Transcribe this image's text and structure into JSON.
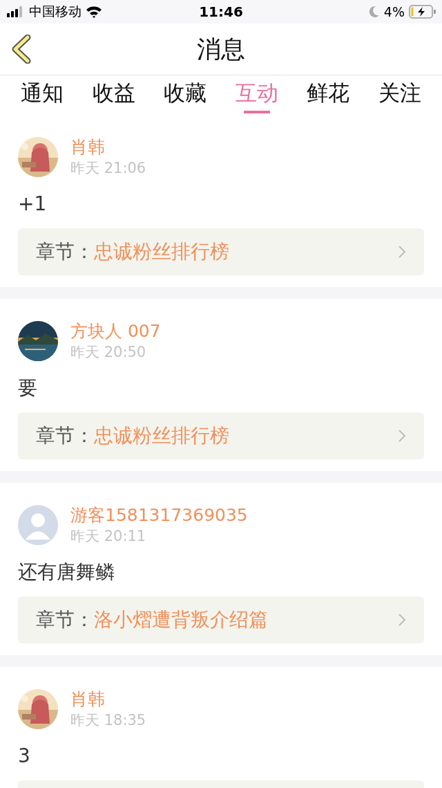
{
  "status_bar": {
    "carrier": "中国移动",
    "time": "11:46",
    "battery": "4%"
  },
  "header": {
    "title": "消息"
  },
  "tabs": [
    {
      "label": "通知",
      "selected": false
    },
    {
      "label": "收益",
      "selected": false
    },
    {
      "label": "收藏",
      "selected": false
    },
    {
      "label": "互动",
      "selected": true
    },
    {
      "label": "鲜花",
      "selected": false
    },
    {
      "label": "关注",
      "selected": false
    }
  ],
  "messages": [
    {
      "name": "肖韩",
      "time": "昨天 21:06",
      "text": "+1",
      "chapter_label": "章节：",
      "chapter": "忠诚粉丝排行榜"
    },
    {
      "name": "方块人 007",
      "time": "昨天 20:50",
      "text": "要",
      "chapter_label": "章节：",
      "chapter": "忠诚粉丝排行榜"
    },
    {
      "avatar": {
        "kind": "default"
      },
      "name": "游客1581317369035",
      "time": "昨天 20:11",
      "text": "还有唐舞鳞",
      "chapter_label": "章节：",
      "chapter": "洛小熠遭背叛介绍篇"
    },
    {
      "name": "肖韩",
      "time": "昨天 18:35",
      "text": "3"
    }
  ]
}
